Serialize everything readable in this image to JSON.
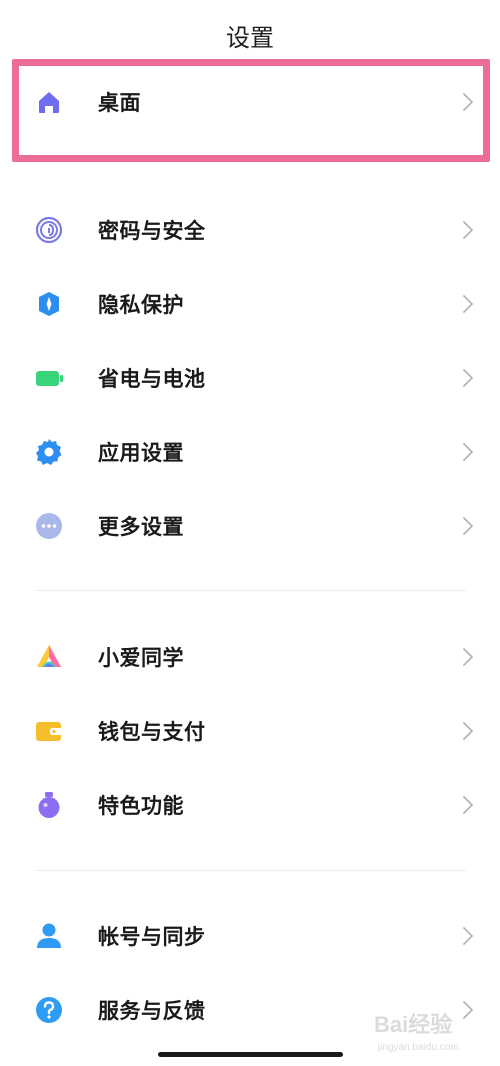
{
  "header": {
    "title": "设置"
  },
  "groups": [
    {
      "items": [
        {
          "label": "桌面",
          "icon": "home-icon",
          "color": "#6f6cf0"
        }
      ]
    },
    {
      "items": [
        {
          "label": "密码与安全",
          "icon": "fingerprint-icon",
          "color": "#7a7ae6"
        },
        {
          "label": "隐私保护",
          "icon": "privacy-shield-icon",
          "color": "#2c8ff0"
        },
        {
          "label": "省电与电池",
          "icon": "battery-icon",
          "color": "#39d37c"
        },
        {
          "label": "应用设置",
          "icon": "gear-icon",
          "color": "#2f8ef2"
        },
        {
          "label": "更多设置",
          "icon": "more-dots-icon",
          "color": "#a8b8e8"
        }
      ]
    },
    {
      "items": [
        {
          "label": "小爱同学",
          "icon": "xiaoai-icon",
          "color": "#ff6fa0"
        },
        {
          "label": "钱包与支付",
          "icon": "wallet-icon",
          "color": "#f5be2b"
        },
        {
          "label": "特色功能",
          "icon": "flask-icon",
          "color": "#8b6ff0"
        }
      ]
    },
    {
      "items": [
        {
          "label": "帐号与同步",
          "icon": "account-icon",
          "color": "#2e9bf4"
        },
        {
          "label": "服务与反馈",
          "icon": "help-icon",
          "color": "#2e9bf4"
        }
      ]
    }
  ],
  "highlight_color": "#ec6d97",
  "watermark": {
    "text": "Bai经验",
    "subtext": "jingyan.baidu.com"
  }
}
